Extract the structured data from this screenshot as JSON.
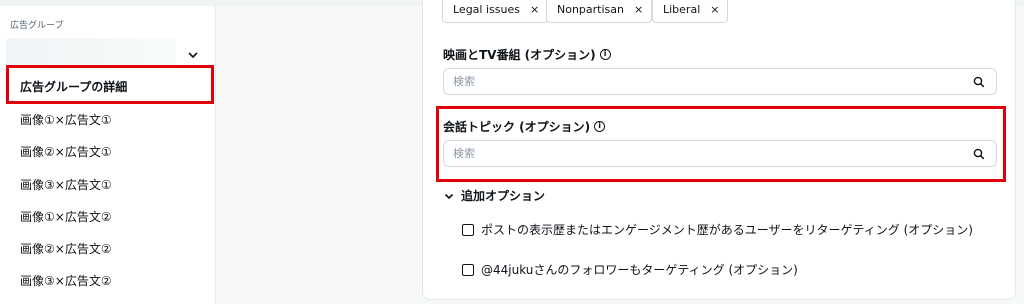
{
  "sidebar": {
    "section_title": "広告グループ",
    "active_item": "広告グループの詳細",
    "items": [
      "画像①×広告文①",
      "画像②×広告文①",
      "画像③×広告文①",
      "画像①×広告文②",
      "画像②×広告文②",
      "画像③×広告文②"
    ]
  },
  "tags": [
    {
      "label": "Legal issues",
      "remove": "×"
    },
    {
      "label": "Nonpartisan",
      "remove": "×"
    },
    {
      "label": "Liberal",
      "remove": "×"
    }
  ],
  "movies_tv": {
    "label": "映画とTV番組 (オプション)",
    "placeholder": "検索"
  },
  "conversation_topics": {
    "label": "会話トピック (オプション)",
    "placeholder": "検索"
  },
  "additional_options": {
    "label": "追加オプション",
    "checkboxes": [
      {
        "label": "ポストの表示歴またはエンゲージメント歴があるユーザーをリターゲティング (オプション)",
        "checked": false
      },
      {
        "label": "@44jukuさんのフォロワーもターゲティング (オプション)",
        "checked": false
      }
    ]
  },
  "colors": {
    "highlight": "#e0000b",
    "text": "#0f1419",
    "border": "#cfd9de"
  }
}
